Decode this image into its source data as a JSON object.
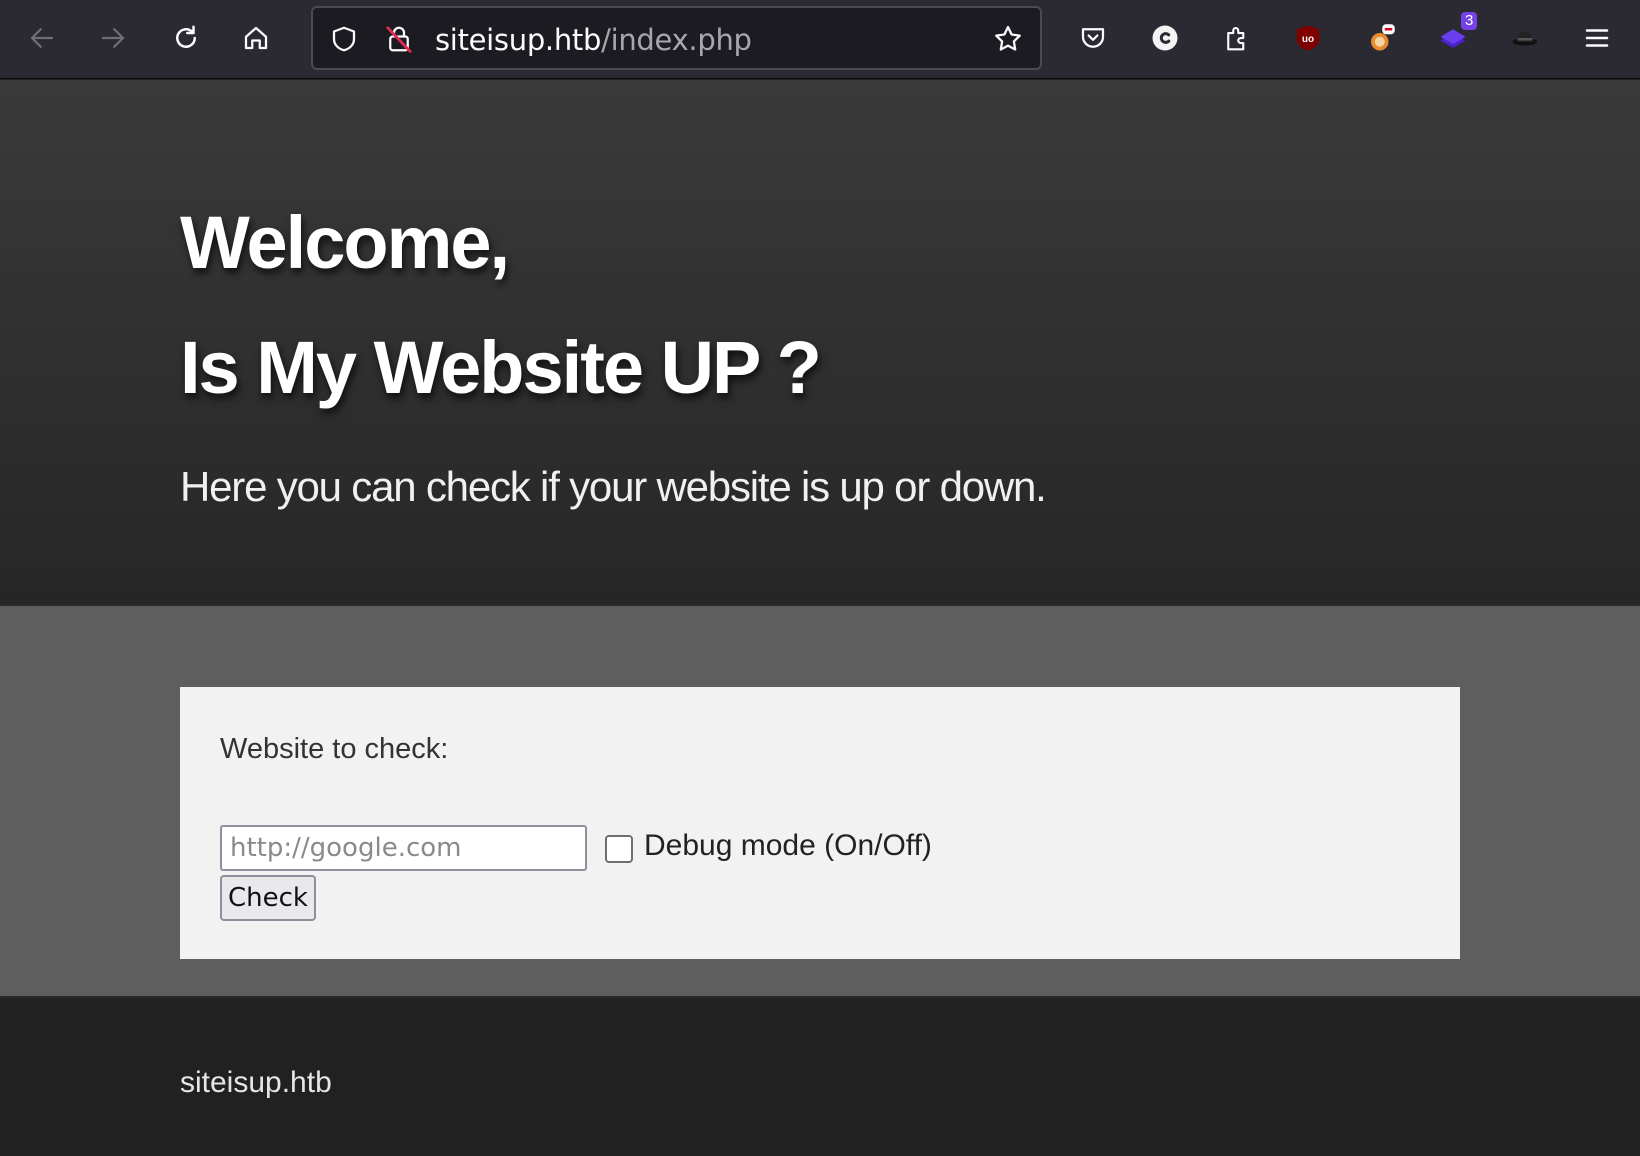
{
  "browser": {
    "url_host": "siteisup.htb",
    "url_path": "/index.php",
    "extension_badge_count": "3"
  },
  "hero": {
    "line1": "Welcome,",
    "line2": "Is My Website UP ?",
    "subtitle": "Here you can check if your website is up or down."
  },
  "form": {
    "label": "Website to check:",
    "input_placeholder": "http://google.com",
    "input_value": "",
    "debug_label": "Debug mode (On/Off)",
    "debug_checked": false,
    "check_button": "Check"
  },
  "footer": {
    "text": "siteisup.htb"
  },
  "colors": {
    "toolbar_bg": "#2b2a33",
    "urlbar_bg": "#1c1b22",
    "hero_top": "#3a3a3a",
    "hero_bottom": "#262626",
    "band_bg": "#5f5e5f",
    "card_bg": "#f2f2f2",
    "footer_bg": "#212121"
  },
  "icons": [
    "back-icon",
    "forward-icon",
    "reload-icon",
    "home-icon",
    "shield-icon",
    "insecure-lock-icon",
    "bookmark-star-icon",
    "pocket-icon",
    "c-extension-icon",
    "extensions-puzzle-icon",
    "ublock-icon",
    "foxyproxy-icon",
    "stack-extension-icon",
    "hat-extension-icon",
    "menu-icon"
  ]
}
